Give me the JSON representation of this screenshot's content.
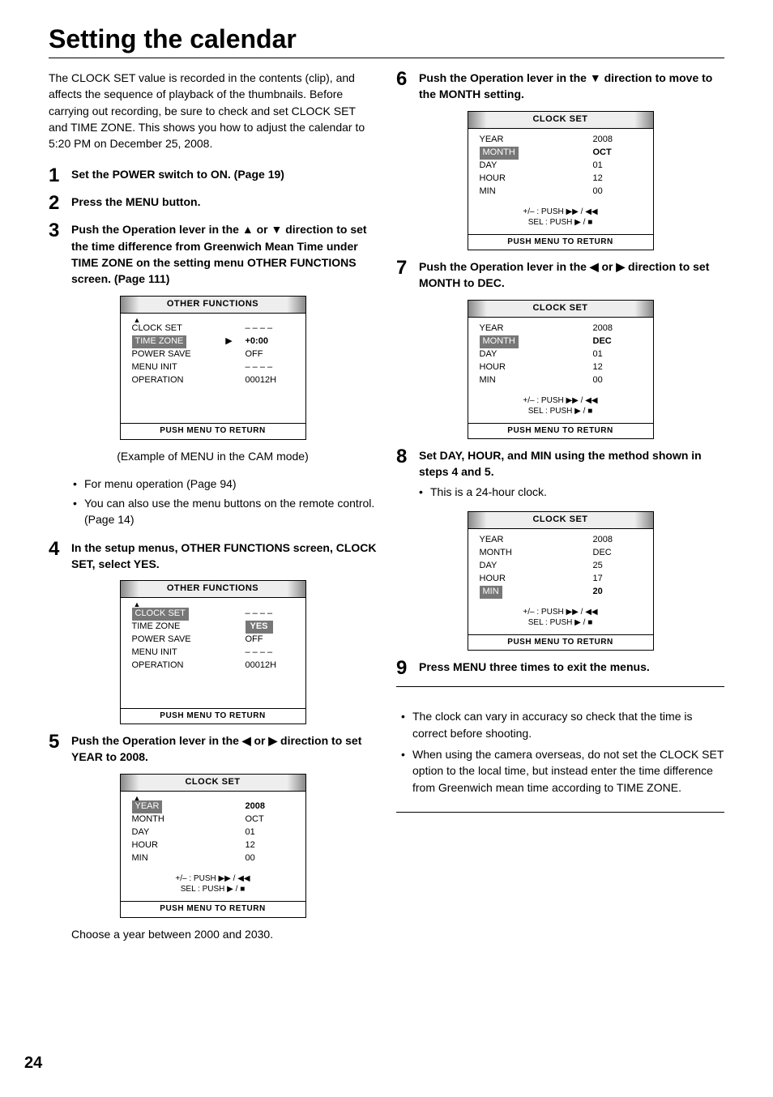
{
  "title": "Setting the calendar",
  "intro": "The CLOCK SET value is recorded in the contents (clip), and affects the sequence of playback of the thumbnails. Before carrying out recording, be sure to check and set CLOCK SET and TIME ZONE. This shows you how to adjust the calendar to 5:20 PM on December 25, 2008.",
  "steps": {
    "s1": {
      "num": "1",
      "head": "Set the POWER switch to ON. (Page 19)"
    },
    "s2": {
      "num": "2",
      "head": "Press the MENU button."
    },
    "s3": {
      "num": "3",
      "head": "Push the Operation lever in the ▲ or ▼ direction to set the time difference from Greenwich Mean Time under TIME ZONE on the setting menu OTHER FUNCTIONS screen. (Page 111)"
    },
    "s4": {
      "num": "4",
      "head": "In the setup menus, OTHER FUNCTIONS screen, CLOCK SET, select YES."
    },
    "s5": {
      "num": "5",
      "head": "Push the Operation lever in the ◀ or ▶ direction to set YEAR to 2008.",
      "tail": "Choose a year between 2000 and 2030."
    },
    "s6": {
      "num": "6",
      "head": "Push the Operation lever in the ▼ direction to move to the MONTH setting."
    },
    "s7": {
      "num": "7",
      "head": "Push the Operation lever in the ◀ or ▶ direction to set MONTH to DEC."
    },
    "s8": {
      "num": "8",
      "head": "Set DAY, HOUR, and MIN using the method shown in steps 4 and 5.",
      "note": "This is a 24-hour clock."
    },
    "s9": {
      "num": "9",
      "head": "Press MENU three times to exit the menus."
    }
  },
  "caption_cam": "(Example of MENU in the CAM mode)",
  "bullets_after3": [
    "For menu operation (Page 94)",
    "You can also use the menu buttons on the remote control. (Page 14)"
  ],
  "notes": [
    "The clock can vary in accuracy so check that the time is correct before shooting.",
    "When using the camera overseas, do not set the CLOCK SET option to the local time, but instead enter the time difference from Greenwich mean time according to TIME ZONE."
  ],
  "menus": {
    "common_footer": "PUSH  MENU TO RETURN",
    "hint_plusminus": "+/– : PUSH ▶▶ / ◀◀",
    "hint_sel": "SEL : PUSH ▶ / ■",
    "other_functions": {
      "title": "OTHER FUNCTIONS",
      "rows": [
        {
          "label": "CLOCK SET",
          "value": "– – – –"
        },
        {
          "label": "TIME ZONE",
          "value": "+0:00",
          "selectedLabel": true,
          "cursor": "▶",
          "boldVal": true
        },
        {
          "label": "POWER SAVE",
          "value": "OFF"
        },
        {
          "label": "MENU INIT",
          "value": "– – – –"
        },
        {
          "label": "OPERATION",
          "value": "00012H"
        }
      ]
    },
    "other_functions_yes": {
      "title": "OTHER FUNCTIONS",
      "rows": [
        {
          "label": "CLOCK SET",
          "value": "– – – –",
          "selectedLabel": true
        },
        {
          "label": "TIME ZONE",
          "value": "YES",
          "selectedVal": true
        },
        {
          "label": "POWER SAVE",
          "value": "OFF"
        },
        {
          "label": "MENU INIT",
          "value": "– – – –"
        },
        {
          "label": "OPERATION",
          "value": "00012H"
        }
      ]
    },
    "clock_set_year": {
      "title": "CLOCK SET",
      "rows": [
        {
          "label": "YEAR",
          "value": "2008",
          "selectedLabel": true,
          "boldVal": true
        },
        {
          "label": "MONTH",
          "value": "OCT"
        },
        {
          "label": "DAY",
          "value": "01"
        },
        {
          "label": "HOUR",
          "value": "12"
        },
        {
          "label": "MIN",
          "value": "00"
        }
      ]
    },
    "clock_set_month_oct": {
      "title": "CLOCK SET",
      "rows": [
        {
          "label": "YEAR",
          "value": "2008"
        },
        {
          "label": "MONTH",
          "value": "OCT",
          "selectedLabel": true,
          "boldVal": true
        },
        {
          "label": "DAY",
          "value": "01"
        },
        {
          "label": "HOUR",
          "value": "12"
        },
        {
          "label": "MIN",
          "value": "00"
        }
      ]
    },
    "clock_set_month_dec": {
      "title": "CLOCK SET",
      "rows": [
        {
          "label": "YEAR",
          "value": "2008"
        },
        {
          "label": "MONTH",
          "value": "DEC",
          "selectedLabel": true,
          "boldVal": true
        },
        {
          "label": "DAY",
          "value": "01"
        },
        {
          "label": "HOUR",
          "value": "12"
        },
        {
          "label": "MIN",
          "value": "00"
        }
      ]
    },
    "clock_set_min": {
      "title": "CLOCK SET",
      "rows": [
        {
          "label": "YEAR",
          "value": "2008"
        },
        {
          "label": "MONTH",
          "value": "DEC"
        },
        {
          "label": "DAY",
          "value": "25"
        },
        {
          "label": "HOUR",
          "value": "17"
        },
        {
          "label": "MIN",
          "value": "20",
          "selectedLabel": true,
          "boldVal": true
        }
      ]
    }
  },
  "page_number": "24"
}
